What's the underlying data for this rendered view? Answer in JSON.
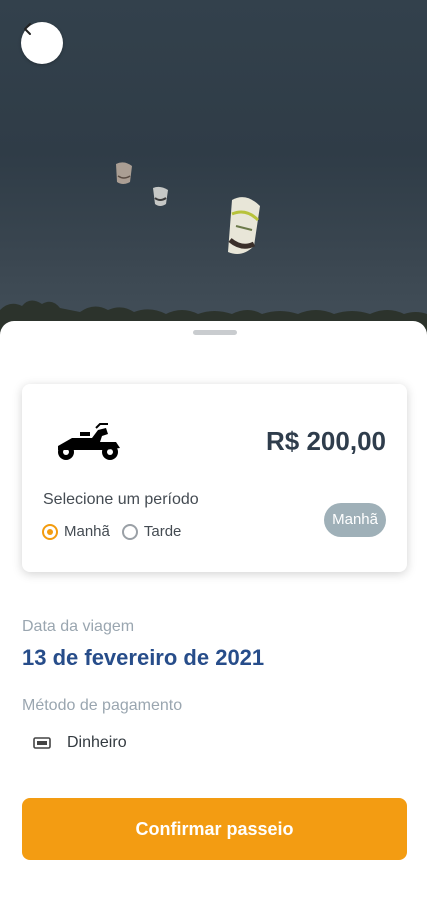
{
  "header": {
    "back_icon": "chevron-left-icon",
    "hero_image": "kites-in-sky-photo"
  },
  "card": {
    "vehicle_icon": "buggy-icon",
    "price": "R$ 200,00",
    "period_prompt": "Selecione um período",
    "periods": [
      {
        "label": "Manhã",
        "selected": true
      },
      {
        "label": "Tarde",
        "selected": false
      }
    ],
    "selected_period_badge": "Manhã"
  },
  "trip": {
    "date_label": "Data da viagem",
    "date_value": "13 de fevereiro de 2021"
  },
  "payment": {
    "label": "Método de pagamento",
    "method": "Dinheiro",
    "method_icon": "cash-icon"
  },
  "actions": {
    "confirm_label": "Confirmar passeio"
  },
  "colors": {
    "accent": "#f39c12",
    "date_text": "#274d8a",
    "badge_bg": "#9fb0b8"
  }
}
